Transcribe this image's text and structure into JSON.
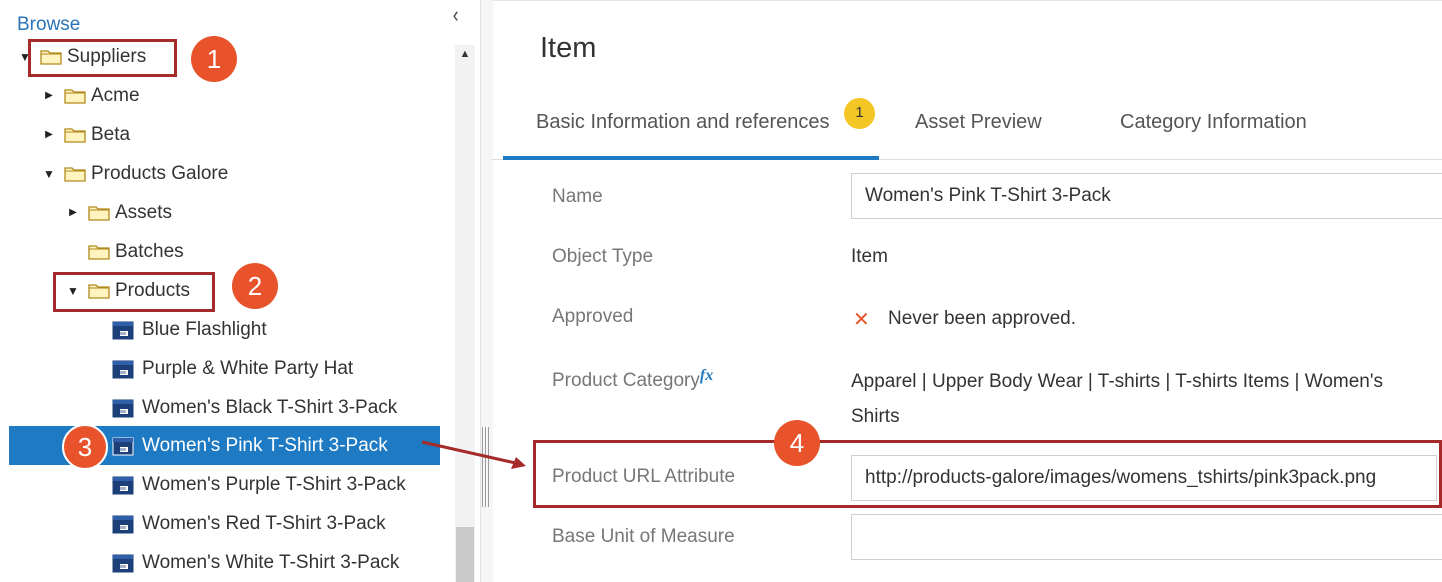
{
  "browse": {
    "label": "Browse",
    "collapse_glyph": "‹",
    "tree": [
      {
        "label": "Suppliers",
        "icon": "folder-icon",
        "expanded": true
      },
      {
        "label": "Acme",
        "icon": "folder-icon",
        "expanded": false
      },
      {
        "label": "Beta",
        "icon": "folder-icon",
        "expanded": false
      },
      {
        "label": "Products Galore",
        "icon": "folder-icon",
        "expanded": true
      },
      {
        "label": "Assets",
        "icon": "folder-icon",
        "expanded": false
      },
      {
        "label": "Batches",
        "icon": "folder-icon"
      },
      {
        "label": "Products",
        "icon": "folder-icon",
        "expanded": true
      },
      {
        "label": "Blue Flashlight",
        "icon": "item-icon"
      },
      {
        "label": "Purple & White Party Hat",
        "icon": "item-icon"
      },
      {
        "label": "Women's Black T-Shirt 3-Pack",
        "icon": "item-icon"
      },
      {
        "label": "Women's Pink T-Shirt 3-Pack",
        "icon": "item-icon",
        "selected": true
      },
      {
        "label": "Women's Purple T-Shirt 3-Pack",
        "icon": "item-icon"
      },
      {
        "label": "Women's Red T-Shirt 3-Pack",
        "icon": "item-icon"
      },
      {
        "label": "Women's White T-Shirt 3-Pack",
        "icon": "item-icon"
      }
    ]
  },
  "detail": {
    "title": "Item",
    "tabs": [
      {
        "label": "Basic Information and references",
        "active": true,
        "badge": "1"
      },
      {
        "label": "Asset Preview"
      },
      {
        "label": "Category Information"
      }
    ],
    "fields": {
      "name_label": "Name",
      "name_value": "Women's Pink T-Shirt 3-Pack",
      "object_type_label": "Object Type",
      "object_type_value": "Item",
      "approved_label": "Approved",
      "approved_value": "Never been approved.",
      "approved_icon": "x-icon",
      "product_category_label": "Product Category",
      "product_category_fx": "fx",
      "product_category_line1": "Apparel | Upper Body Wear | T-shirts | T-shirts Items | Women's",
      "product_category_line2": "Shirts",
      "product_url_label": "Product URL Attribute",
      "product_url_value": "http://products-galore/images/womens_tshirts/pink3pack.png",
      "base_uom_label": "Base Unit of Measure",
      "base_uom_value": ""
    }
  },
  "annotations": {
    "numbers": [
      "1",
      "2",
      "3",
      "4"
    ]
  },
  "colors": {
    "accent": "#1e7ac3",
    "callout": "#e8532b",
    "callout_border": "#a52a2a",
    "badge": "#f3c623"
  }
}
